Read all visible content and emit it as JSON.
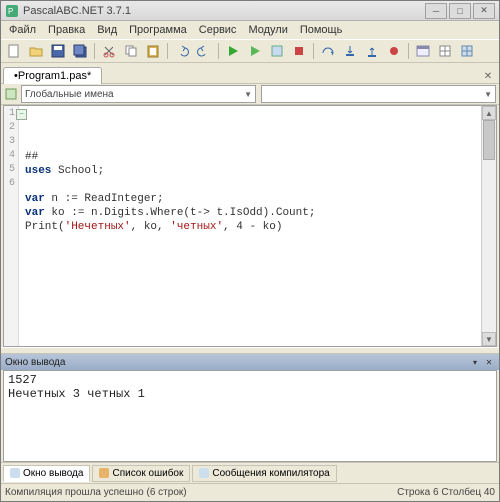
{
  "window": {
    "title": "PascalABC.NET 3.7.1"
  },
  "menu": {
    "items": [
      "Файл",
      "Правка",
      "Вид",
      "Программа",
      "Сервис",
      "Модули",
      "Помощь"
    ]
  },
  "tab": {
    "name": "•Program1.pas*"
  },
  "combo": {
    "label": "Глобальные имена"
  },
  "code": {
    "lines": [
      "##",
      "uses School;",
      "",
      "var n := ReadInteger;",
      "var ko := n.Digits.Where(t-> t.IsOdd).Count;",
      "Print('Нечетных', ko, 'четных', 4 - ko)"
    ],
    "gutter": [
      "1",
      "2",
      "3",
      "4",
      "5",
      "6"
    ]
  },
  "output": {
    "title": "Окно вывода",
    "lines": [
      "1527",
      "Нечетных 3 четных 1"
    ]
  },
  "bottom_tabs": {
    "t1": "Окно вывода",
    "t2": "Список ошибок",
    "t3": "Сообщения компилятора"
  },
  "status": {
    "left": "Компиляция прошла успешно (6 строк)",
    "right": "Строка 6 Столбец 40"
  },
  "colors": {
    "kw": "#0a3279",
    "str": "#a31515"
  }
}
